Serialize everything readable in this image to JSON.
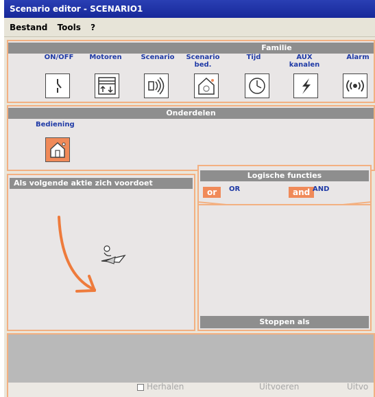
{
  "window": {
    "title": "Scenario editor - SCENARIO1"
  },
  "menu": {
    "items": [
      "Bestand",
      "Tools",
      "?"
    ]
  },
  "familie": {
    "header": "Familie",
    "items": [
      {
        "label": "ON/OFF",
        "icon": "switch-icon"
      },
      {
        "label": "Motoren",
        "icon": "shutter-icon"
      },
      {
        "label": "Scenario",
        "icon": "scenario-icon"
      },
      {
        "label": "Scenario\nbed.",
        "icon": "house-icon"
      },
      {
        "label": "Tijd",
        "icon": "clock-icon"
      },
      {
        "label": "AUX\nkanalen",
        "icon": "lightning-icon"
      },
      {
        "label": "Alarm",
        "icon": "alarm-icon"
      }
    ]
  },
  "onderdelen": {
    "header": "Onderdelen",
    "item_label": "Bediening",
    "item_icon": "house-control-icon"
  },
  "trigger_panel": {
    "header": "Als volgende aktie zich voordoet"
  },
  "logic_panel": {
    "header": "Logische functies",
    "or_chip": "or",
    "or_label": "OR",
    "and_chip": "and",
    "and_label": "AND",
    "stop_header": "Stoppen als"
  },
  "footer": {
    "repeat_label": "Herhalen",
    "execute_label": "Uitvoeren",
    "execute2_label": "Uitvo"
  },
  "colors": {
    "accent": "#f08a59",
    "title_blue": "#2a3fb4",
    "header_grey": "#8e8e8e"
  }
}
